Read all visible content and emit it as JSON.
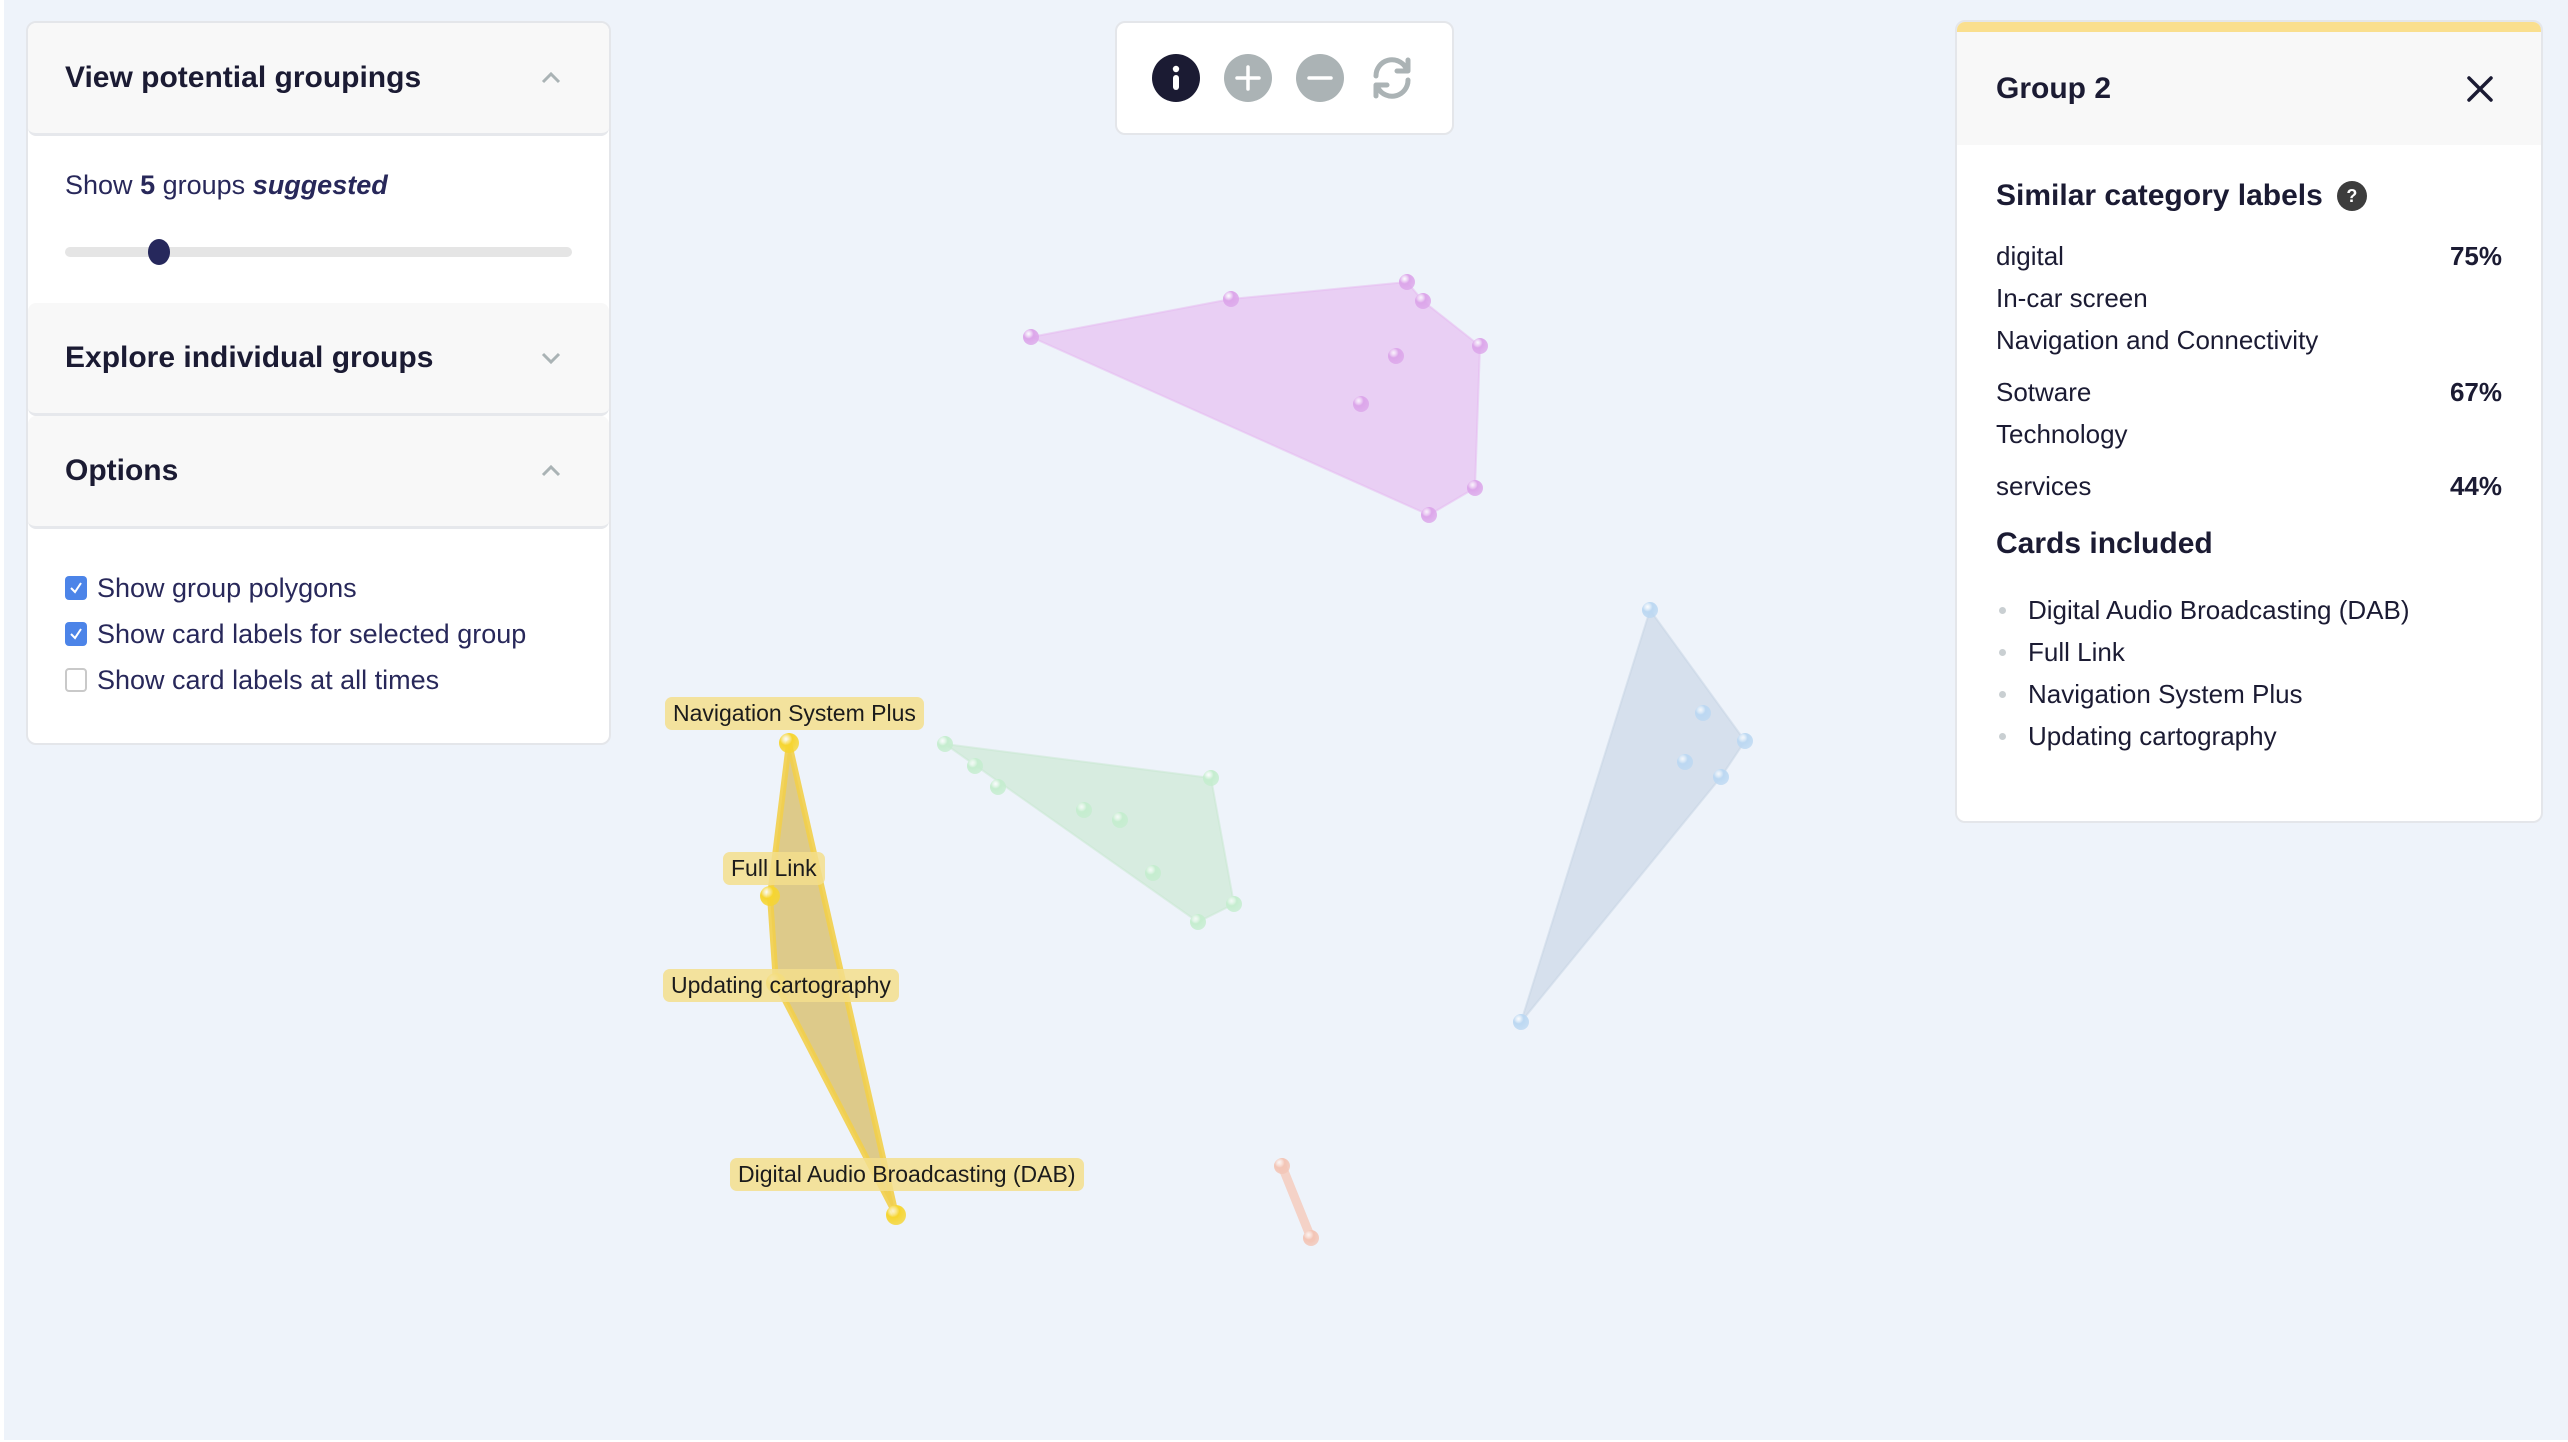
{
  "left_panel": {
    "groupings": {
      "title": "View potential groupings",
      "show_prefix": "Show",
      "group_count": "5",
      "groups_word": "groups",
      "suggested": "suggested",
      "slider_value": 5,
      "slider_min": 2,
      "slider_max": 20
    },
    "explore": {
      "title": "Explore individual groups"
    },
    "options": {
      "title": "Options",
      "items": [
        {
          "label": "Show group polygons",
          "checked": true
        },
        {
          "label": "Show card labels for selected group",
          "checked": true
        },
        {
          "label": "Show card labels at all times",
          "checked": false
        }
      ]
    }
  },
  "toolbar": {
    "buttons": [
      {
        "name": "info",
        "icon": "info-icon"
      },
      {
        "name": "zoom-in",
        "icon": "plus-icon"
      },
      {
        "name": "zoom-out",
        "icon": "minus-icon"
      },
      {
        "name": "reset",
        "icon": "refresh-icon"
      }
    ]
  },
  "right_panel": {
    "title": "Group 2",
    "accent_color": "#fadf8e",
    "similar_title": "Similar category labels",
    "help_glyph": "?",
    "similar_groups": [
      {
        "labels": [
          "digital",
          "In-car screen",
          "Navigation and Connectivity"
        ],
        "percent": "75%"
      },
      {
        "labels": [
          "Sotware",
          "Technology"
        ],
        "percent": "67%"
      },
      {
        "labels": [
          "services"
        ],
        "percent": "44%"
      }
    ],
    "cards_title": "Cards included",
    "cards": [
      "Digital Audio Broadcasting (DAB)",
      "Full Link",
      "Navigation System Plus",
      "Updating cartography"
    ]
  },
  "graph": {
    "selected_group": "Group 2",
    "groups": [
      {
        "name": "group-purple",
        "color": "#e6b8f0",
        "node_color": "#dca6ea",
        "points": [
          [
            1031,
            337
          ],
          [
            1231,
            299
          ],
          [
            1407,
            282
          ],
          [
            1423,
            301
          ],
          [
            1480,
            346
          ],
          [
            1396,
            356
          ],
          [
            1361,
            404
          ],
          [
            1475,
            488
          ],
          [
            1429,
            515
          ]
        ],
        "hull": [
          [
            1031,
            337
          ],
          [
            1231,
            299
          ],
          [
            1407,
            282
          ],
          [
            1423,
            301
          ],
          [
            1480,
            346
          ],
          [
            1475,
            488
          ],
          [
            1429,
            515
          ]
        ]
      },
      {
        "name": "group-green",
        "color": "#c8e8cf",
        "node_color": "#c5edcf",
        "points": [
          [
            945,
            744
          ],
          [
            975,
            766
          ],
          [
            998,
            787
          ],
          [
            1084,
            810
          ],
          [
            1120,
            820
          ],
          [
            1153,
            873
          ],
          [
            1211,
            778
          ],
          [
            1234,
            904
          ],
          [
            1198,
            922
          ]
        ],
        "hull": [
          [
            945,
            744
          ],
          [
            1211,
            778
          ],
          [
            1234,
            904
          ],
          [
            1198,
            922
          ]
        ]
      },
      {
        "name": "group-blue",
        "color": "#c6d3e4",
        "node_color": "#bcd8f2",
        "points": [
          [
            1650,
            610
          ],
          [
            1703,
            713
          ],
          [
            1745,
            741
          ],
          [
            1685,
            762
          ],
          [
            1721,
            777
          ],
          [
            1521,
            1022
          ]
        ],
        "hull": [
          [
            1650,
            610
          ],
          [
            1745,
            741
          ],
          [
            1721,
            777
          ],
          [
            1521,
            1022
          ]
        ]
      },
      {
        "name": "group-orange",
        "color": "#f4cbbd",
        "node_color": "#f3c5b6",
        "points": [
          [
            1282,
            1166
          ],
          [
            1311,
            1238
          ]
        ],
        "hull": [
          [
            1282,
            1166
          ],
          [
            1311,
            1238
          ]
        ]
      },
      {
        "name": "group-2-yellow",
        "color": "#d9c276",
        "node_color": "#f6d530",
        "selected": true,
        "points": [
          [
            789,
            743
          ],
          [
            770,
            896
          ],
          [
            776,
            983
          ],
          [
            896,
            1215
          ]
        ],
        "hull": [
          [
            789,
            743
          ],
          [
            896,
            1215
          ],
          [
            776,
            983
          ],
          [
            770,
            896
          ]
        ]
      }
    ],
    "labels": [
      {
        "text": "Navigation System Plus",
        "at": [
          665,
          697
        ]
      },
      {
        "text": "Full Link",
        "at": [
          723,
          852
        ]
      },
      {
        "text": "Updating cartography",
        "at": [
          663,
          969
        ]
      },
      {
        "text": "Digital Audio Broadcasting (DAB)",
        "at": [
          730,
          1158
        ]
      }
    ]
  }
}
